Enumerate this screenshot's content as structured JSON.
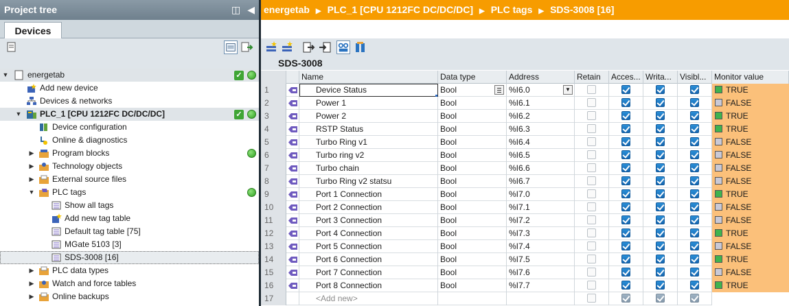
{
  "left_panel": {
    "title": "Project tree",
    "tab": "Devices",
    "tree": [
      {
        "label": "energetab",
        "status_check": true,
        "status_dot": true
      },
      {
        "label": "Add new device"
      },
      {
        "label": "Devices & networks"
      },
      {
        "label": "PLC_1 [CPU 1212FC DC/DC/DC]",
        "status_check": true,
        "status_dot": true
      },
      {
        "label": "Device configuration"
      },
      {
        "label": "Online & diagnostics"
      },
      {
        "label": "Program blocks",
        "status_dot": true
      },
      {
        "label": "Technology objects"
      },
      {
        "label": "External source files"
      },
      {
        "label": "PLC tags",
        "status_dot": true
      },
      {
        "label": "Show all tags"
      },
      {
        "label": "Add new tag table"
      },
      {
        "label": "Default tag table [75]"
      },
      {
        "label": "MGate 5103 [3]"
      },
      {
        "label": "SDS-3008 [16]"
      },
      {
        "label": "PLC data types"
      },
      {
        "label": "Watch and force tables"
      },
      {
        "label": "Online backups"
      }
    ]
  },
  "breadcrumb": [
    "energetab",
    "PLC_1 [CPU 1212FC DC/DC/DC]",
    "PLC tags",
    "SDS-3008 [16]"
  ],
  "table_title": "SDS-3008",
  "columns": {
    "name": "Name",
    "data_type": "Data type",
    "address": "Address",
    "retain": "Retain",
    "accessible": "Acces...",
    "writable": "Writa...",
    "visible": "Visibl...",
    "monitor": "Monitor value"
  },
  "rows": [
    {
      "num": "1",
      "name": "Device Status",
      "type": "Bool",
      "address": "%I6.0",
      "monitor": "TRUE"
    },
    {
      "num": "2",
      "name": "Power 1",
      "type": "Bool",
      "address": "%I6.1",
      "monitor": "FALSE"
    },
    {
      "num": "3",
      "name": "Power 2",
      "type": "Bool",
      "address": "%I6.2",
      "monitor": "TRUE"
    },
    {
      "num": "4",
      "name": "RSTP Status",
      "type": "Bool",
      "address": "%I6.3",
      "monitor": "TRUE"
    },
    {
      "num": "5",
      "name": "Turbo Ring v1",
      "type": "Bool",
      "address": "%I6.4",
      "monitor": "FALSE"
    },
    {
      "num": "6",
      "name": "Turbo ring v2",
      "type": "Bool",
      "address": "%I6.5",
      "monitor": "FALSE"
    },
    {
      "num": "7",
      "name": "Turbo chain",
      "type": "Bool",
      "address": "%I6.6",
      "monitor": "FALSE"
    },
    {
      "num": "8",
      "name": "Turbo Ring v2 statsu",
      "type": "Bool",
      "address": "%I6.7",
      "monitor": "FALSE"
    },
    {
      "num": "9",
      "name": "Port 1 Connection",
      "type": "Bool",
      "address": "%I7.0",
      "monitor": "TRUE"
    },
    {
      "num": "10",
      "name": "Port 2 Connection",
      "type": "Bool",
      "address": "%I7.1",
      "monitor": "FALSE"
    },
    {
      "num": "11",
      "name": "Port 3 Connection",
      "type": "Bool",
      "address": "%I7.2",
      "monitor": "FALSE"
    },
    {
      "num": "12",
      "name": "Port 4 Connection",
      "type": "Bool",
      "address": "%I7.3",
      "monitor": "TRUE"
    },
    {
      "num": "13",
      "name": "Port 5 Connection",
      "type": "Bool",
      "address": "%I7.4",
      "monitor": "FALSE"
    },
    {
      "num": "14",
      "name": "Port 6 Connection",
      "type": "Bool",
      "address": "%I7.5",
      "monitor": "TRUE"
    },
    {
      "num": "15",
      "name": "Port 7 Connection",
      "type": "Bool",
      "address": "%I7.6",
      "monitor": "FALSE"
    },
    {
      "num": "16",
      "name": "Port 8 Connection",
      "type": "Bool",
      "address": "%I7.7",
      "monitor": "TRUE"
    }
  ],
  "add_new_row": {
    "num": "17",
    "name": "<Add new>"
  },
  "colors": {
    "accent": "#f79c00",
    "monitor_bg": "#fbc07a",
    "true": "#3fb34f",
    "false": "#c9c9d6",
    "checkbox": "#1767b0"
  }
}
